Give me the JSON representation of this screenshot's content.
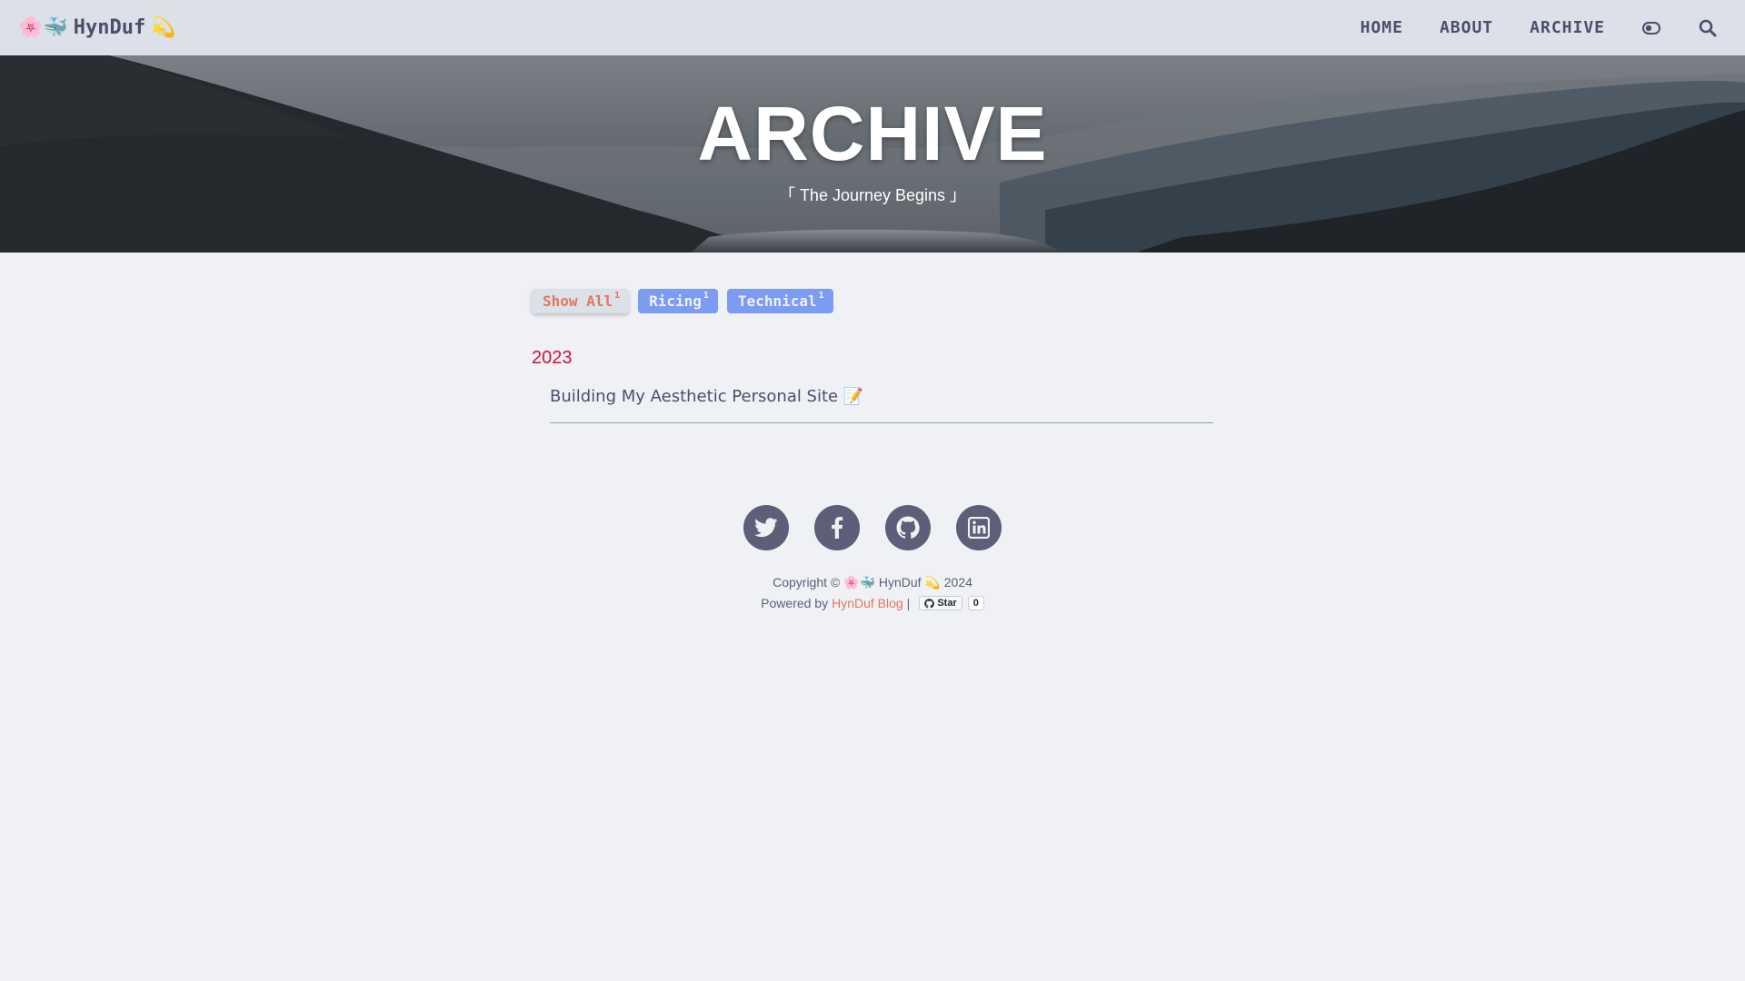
{
  "navbar": {
    "brand_prefix": "🌸🐳",
    "brand_name": "HynDuf",
    "brand_suffix": "💫",
    "links": [
      {
        "label": "HOME"
      },
      {
        "label": "ABOUT"
      },
      {
        "label": "ARCHIVE"
      }
    ],
    "theme_toggle_icon": "toggle-icon",
    "search_icon": "search-icon"
  },
  "hero": {
    "title": "ARCHIVE",
    "subtitle": "「 The Journey Begins 」"
  },
  "tags": [
    {
      "label": "Show All",
      "count": "1",
      "active": true
    },
    {
      "label": "Ricing",
      "count": "1",
      "active": false
    },
    {
      "label": "Technical",
      "count": "1",
      "active": false
    }
  ],
  "archive": [
    {
      "year": "2023",
      "posts": [
        {
          "title": "Building My Aesthetic Personal Site 📝"
        }
      ]
    }
  ],
  "footer": {
    "social": [
      "twitter-icon",
      "facebook-icon",
      "github-icon",
      "linkedin-icon"
    ],
    "copyright": "Copyright © 🌸🐳 HynDuf 💫 2024",
    "powered_prefix": "Powered by",
    "powered_link": "HynDuf Blog",
    "separator": "|",
    "github_star_label": "Star",
    "github_star_count": "0"
  },
  "colors": {
    "background": "#eff1f5",
    "navbar": "#dce0e8",
    "text": "#4c4f69",
    "year": "#d20f39",
    "tag_active_text": "#e0785a",
    "tag_bg": "#7c9cf4",
    "social_bg": "#5c5f77"
  }
}
